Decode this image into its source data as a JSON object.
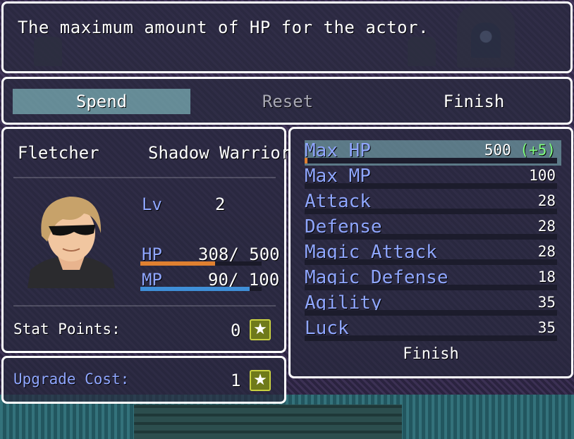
{
  "help": {
    "text": "The maximum amount of HP for the actor."
  },
  "commands": [
    {
      "label": "Spend",
      "state": "selected"
    },
    {
      "label": "Reset",
      "state": "disabled"
    },
    {
      "label": "Finish",
      "state": "enabled"
    }
  ],
  "actor": {
    "name": "Fletcher",
    "class": "Shadow Warrior",
    "level_label": "Lv",
    "level": "2",
    "hp_label": "HP",
    "hp_value": "308/ 500",
    "hp_fraction": 0.616,
    "mp_label": "MP",
    "mp_value": "90/ 100",
    "mp_fraction": 0.9
  },
  "points": {
    "label": "Stat Points:",
    "value": "0",
    "icon": "star-icon"
  },
  "cost": {
    "label": "Upgrade Cost:",
    "value": "1",
    "icon": "star-icon"
  },
  "stats": [
    {
      "name": "Max HP",
      "value": "500",
      "bonus": "(+5)",
      "selected": true,
      "fill": 0.01
    },
    {
      "name": "Max MP",
      "value": "100",
      "bonus": "",
      "selected": false,
      "fill": 0
    },
    {
      "name": "Attack",
      "value": "28",
      "bonus": "",
      "selected": false,
      "fill": 0
    },
    {
      "name": "Defense",
      "value": "28",
      "bonus": "",
      "selected": false,
      "fill": 0
    },
    {
      "name": "Magic Attack",
      "value": "28",
      "bonus": "",
      "selected": false,
      "fill": 0
    },
    {
      "name": "Magic Defense",
      "value": "18",
      "bonus": "",
      "selected": false,
      "fill": 0
    },
    {
      "name": "Agility",
      "value": "35",
      "bonus": "",
      "selected": false,
      "fill": 0
    },
    {
      "name": "Luck",
      "value": "35",
      "bonus": "",
      "selected": false,
      "fill": 0
    }
  ],
  "stats_footer": "Finish",
  "colors": {
    "hp_gauge": "#e08030",
    "mp_gauge": "#3f8fd8",
    "system": "#8fa6ff",
    "bonus": "#80ff80"
  }
}
